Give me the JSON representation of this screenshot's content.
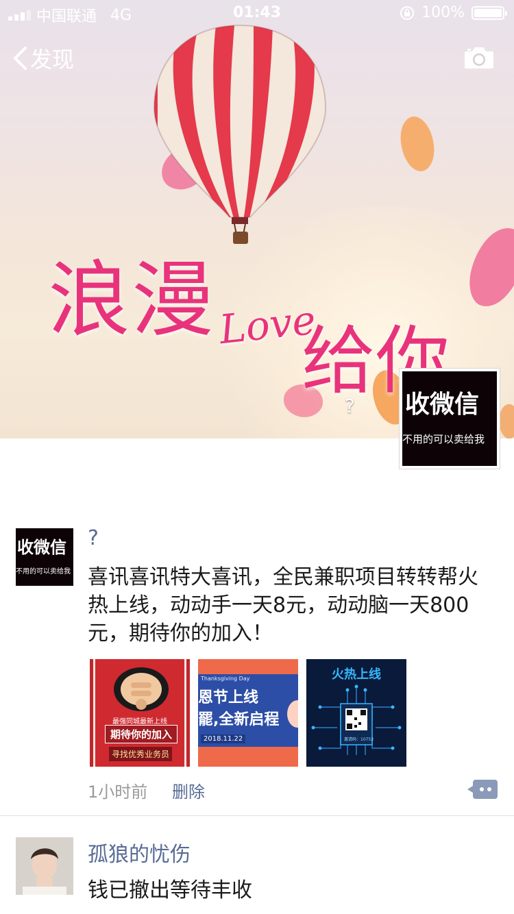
{
  "status_bar": {
    "carrier": "中国联通",
    "network": "4G",
    "time": "01:43",
    "battery": "100%"
  },
  "nav": {
    "back_label": "发现",
    "camera_icon": "camera-icon"
  },
  "cover": {
    "overlay_title_1": "浪漫",
    "overlay_love": "Love",
    "overlay_title_2": "给你",
    "nickname": "?"
  },
  "profile_avatar": {
    "big_text": "收微信",
    "small_text": "不用的可以卖给我"
  },
  "posts": [
    {
      "author": "?",
      "text": "喜讯喜讯特大喜讯，全民兼职项目转转帮火热上线，动动手一天8元，动动脑一天800元，期待你的加入！",
      "avatar_big_text": "收微信",
      "avatar_small_text": "不用的可以卖给我",
      "photos": [
        {
          "line1": "期待你的加入",
          "line2": "寻找优秀业务员",
          "banner": "最强同城最新上线"
        },
        {
          "line1": "恩节上线",
          "line2": "罷,全新启程",
          "date": "2018.11.22",
          "tag": "Thanksgiving Day"
        },
        {
          "line1": "火热上线",
          "code": "邀请码：10753"
        }
      ],
      "time": "1小时前",
      "delete_label": "删除"
    },
    {
      "author": "孤狼的忧伤",
      "text": "钱已撤出等待丰收"
    }
  ],
  "colors": {
    "link": "#576b95",
    "accent_pink": "#e8337c"
  }
}
